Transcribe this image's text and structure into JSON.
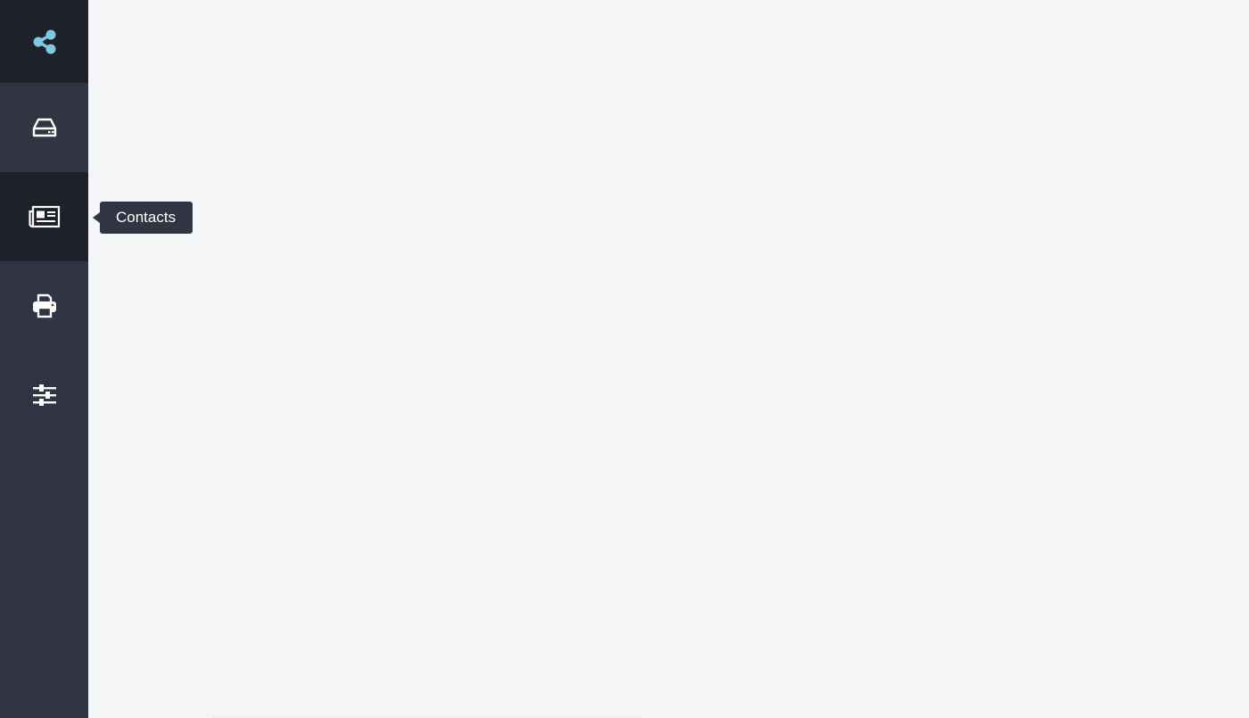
{
  "app": {
    "logo_icon": "share-icon",
    "logo_color": "#7ec8e3"
  },
  "sidebar": {
    "background": "#303443",
    "active_background": "#1f212a",
    "items": [
      {
        "id": "inbox",
        "icon": "inbox-tray-icon",
        "active": false
      },
      {
        "id": "contacts",
        "icon": "newspaper-icon",
        "active": true
      },
      {
        "id": "print",
        "icon": "printer-icon",
        "active": false
      },
      {
        "id": "settings",
        "icon": "sliders-icon",
        "active": false
      }
    ]
  },
  "tooltip": {
    "label": "Contacts"
  },
  "main": {
    "background": "#f4f5f7"
  }
}
